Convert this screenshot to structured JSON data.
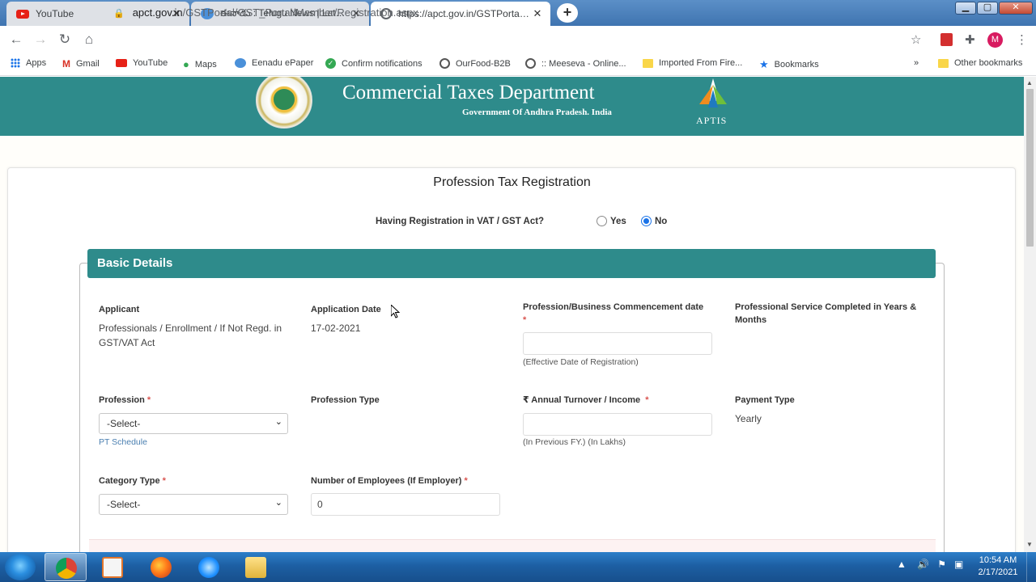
{
  "browser": {
    "tabs": [
      {
        "title": "YouTube",
        "active": false,
        "icon": "youtube-icon"
      },
      {
        "title": "ఈనాడు : Telugu News | Latest Tel",
        "active": false,
        "icon": "eenadu-icon"
      },
      {
        "title": "https://apct.gov.in/GSTPortal/GS",
        "active": true,
        "icon": "globe-icon"
      }
    ],
    "new_tab_label": "+",
    "url_host": "apct.gov.in",
    "url_path": "/GSTPortal/GST_Portal/Member/Registration.aspx",
    "profile_initial": "M",
    "bookmarks": [
      {
        "label": "Apps",
        "icon": "apps-grid-icon"
      },
      {
        "label": "Gmail",
        "icon": "gmail-icon"
      },
      {
        "label": "YouTube",
        "icon": "youtube-icon"
      },
      {
        "label": "Maps",
        "icon": "maps-icon"
      },
      {
        "label": "Eenadu ePaper",
        "icon": "eenadu-icon"
      },
      {
        "label": "Confirm notifications",
        "icon": "check-circle-icon"
      },
      {
        "label": "OurFood-B2B",
        "icon": "globe-icon"
      },
      {
        "label": ":: Meeseva - Online...",
        "icon": "globe-icon"
      },
      {
        "label": "Imported From Fire...",
        "icon": "folder-icon"
      },
      {
        "label": "Bookmarks",
        "icon": "star-icon"
      }
    ],
    "bookmarks_overflow": "»",
    "other_bookmarks": "Other bookmarks"
  },
  "header": {
    "title": "Commercial Taxes Department",
    "subtitle": "Government Of Andhra Pradesh. India",
    "brand": "APTIS",
    "brand_color": "#2e8b8b"
  },
  "form": {
    "title": "Profession Tax Registration",
    "vat_question": "Having Registration in VAT / GST Act?",
    "vat_options": [
      {
        "label": "Yes",
        "checked": false
      },
      {
        "label": "No",
        "checked": true
      }
    ],
    "section_title": "Basic Details",
    "fields": {
      "applicant": {
        "label": "Applicant",
        "value": "Professionals / Enrollment / If Not Regd. in GST/VAT Act"
      },
      "application_date": {
        "label": "Application Date",
        "value": "17-02-2021"
      },
      "commencement_date": {
        "label": "Profession/Business Commencement date",
        "required": "*",
        "value": "",
        "help": "(Effective Date of Registration)"
      },
      "service_completed": {
        "label": "Professional Service Completed in Years & Months"
      },
      "profession": {
        "label": "Profession",
        "required": "*",
        "selected": "-Select-",
        "link": "PT Schedule"
      },
      "profession_type": {
        "label": "Profession Type"
      },
      "annual_turnover": {
        "label": "₹ Annual Turnover / Income",
        "required": "*",
        "value": "",
        "help": "(In Previous FY.) (In Lakhs)"
      },
      "payment_type": {
        "label": "Payment Type",
        "value": "Yearly"
      },
      "category_type": {
        "label": "Category Type",
        "required": "*",
        "selected": "-Select-"
      },
      "employees": {
        "label": "Number of Employees (If Employer)",
        "required": "*",
        "value": "0"
      }
    }
  },
  "taskbar": {
    "time": "10:54 AM",
    "date": "2/17/2021"
  }
}
